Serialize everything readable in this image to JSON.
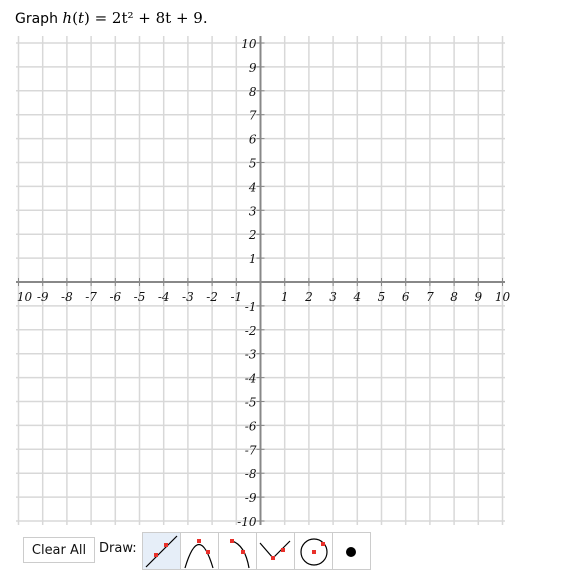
{
  "prompt": {
    "lead": "Graph",
    "fn": "h",
    "var": "t",
    "equation_rest": " = 2t² + 8t + 9."
  },
  "graph": {
    "xlim": [
      -10,
      10
    ],
    "ylim": [
      -10,
      10
    ],
    "grid": true,
    "x_tick_labels": [
      "10",
      "-9",
      "-8",
      "-7",
      "-6",
      "-5",
      "-4",
      "-3",
      "-2",
      "-1",
      "1",
      "2",
      "3",
      "4",
      "5",
      "6",
      "7",
      "8",
      "9",
      "10"
    ],
    "y_tick_labels": [
      "10",
      "9",
      "8",
      "7",
      "6",
      "5",
      "4",
      "3",
      "2",
      "1",
      "-1",
      "-2",
      "-3",
      "-4",
      "-5",
      "-6",
      "-7",
      "-8",
      "-9",
      "-10"
    ],
    "grid_color": "#d8d8d8",
    "axis_color": "#888888"
  },
  "toolbar": {
    "clear_label": "Clear All",
    "draw_label": "Draw:",
    "tools": [
      {
        "name": "line",
        "icon": "line-tool-icon",
        "active": true
      },
      {
        "name": "parabola",
        "icon": "parabola-tool-icon",
        "active": false
      },
      {
        "name": "half-parabola",
        "icon": "half-parabola-tool-icon",
        "active": false
      },
      {
        "name": "absolute-value",
        "icon": "absolute-value-tool-icon",
        "active": false
      },
      {
        "name": "circle",
        "icon": "circle-tool-icon",
        "active": false
      },
      {
        "name": "point",
        "icon": "point-tool-icon",
        "active": false
      }
    ],
    "marker_color": "#e8302a"
  }
}
